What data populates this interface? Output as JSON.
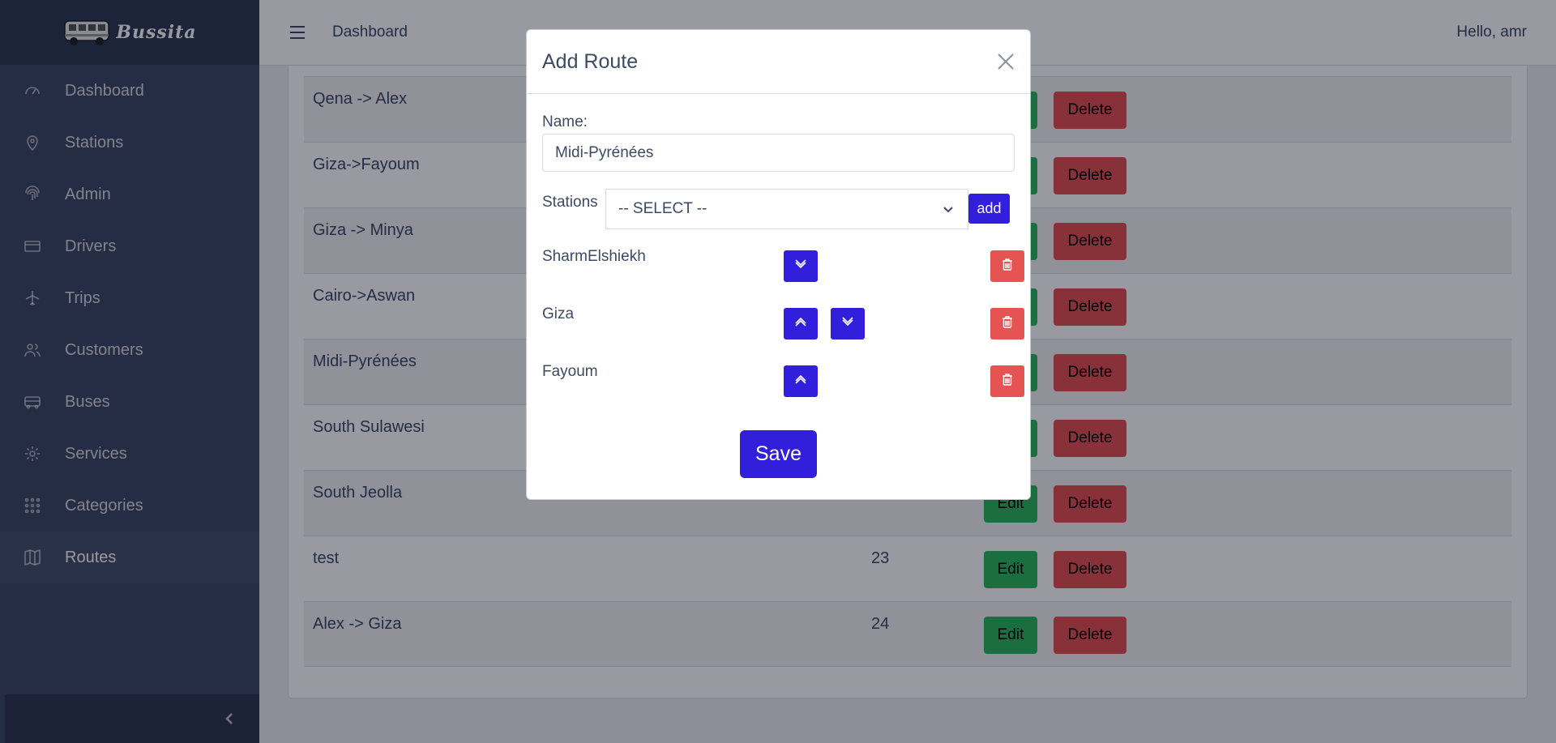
{
  "brand": {
    "name": "Bussita"
  },
  "sidebar": {
    "items": [
      {
        "label": "Dashboard",
        "icon": "speedometer-icon",
        "active": false
      },
      {
        "label": "Stations",
        "icon": "location-pin-icon",
        "active": false
      },
      {
        "label": "Admin",
        "icon": "fingerprint-icon",
        "active": false
      },
      {
        "label": "Drivers",
        "icon": "credit-card-icon",
        "active": false
      },
      {
        "label": "Trips",
        "icon": "airplane-icon",
        "active": false
      },
      {
        "label": "Customers",
        "icon": "people-icon",
        "active": false
      },
      {
        "label": "Buses",
        "icon": "bus-icon",
        "active": false
      },
      {
        "label": "Services",
        "icon": "gear-icon",
        "active": false
      },
      {
        "label": "Categories",
        "icon": "grid-dots-icon",
        "active": false
      },
      {
        "label": "Routes",
        "icon": "map-icon",
        "active": true
      }
    ]
  },
  "header": {
    "title": "Dashboard",
    "greeting": "Hello, amr"
  },
  "table": {
    "edit_label": "Edit",
    "delete_label": "Delete",
    "rows": [
      {
        "name": "Qena -> Alex",
        "count": ""
      },
      {
        "name": "Giza->Fayoum",
        "count": ""
      },
      {
        "name": "Giza -> Minya",
        "count": ""
      },
      {
        "name": "Cairo->Aswan",
        "count": ""
      },
      {
        "name": "Midi-Pyrénées",
        "count": ""
      },
      {
        "name": "South Sulawesi",
        "count": ""
      },
      {
        "name": "South Jeolla",
        "count": ""
      },
      {
        "name": "test",
        "count": "23"
      },
      {
        "name": "Alex -> Giza",
        "count": "24"
      }
    ]
  },
  "modal": {
    "title": "Add Route",
    "name_label": "Name:",
    "name_value": "Midi-Pyrénées",
    "stations_label": "Stations",
    "select_value": "-- SELECT --",
    "add_label": "add",
    "save_label": "Save",
    "stations": [
      {
        "name": "SharmElshiekh",
        "can_up": false,
        "can_down": true
      },
      {
        "name": "Giza",
        "can_up": true,
        "can_down": true
      },
      {
        "name": "Fayoum",
        "can_up": true,
        "can_down": false
      }
    ]
  },
  "colors": {
    "sidebar": "#3c4b64",
    "primary": "#321fdb",
    "success": "#2eb85c",
    "danger": "#e55353"
  }
}
